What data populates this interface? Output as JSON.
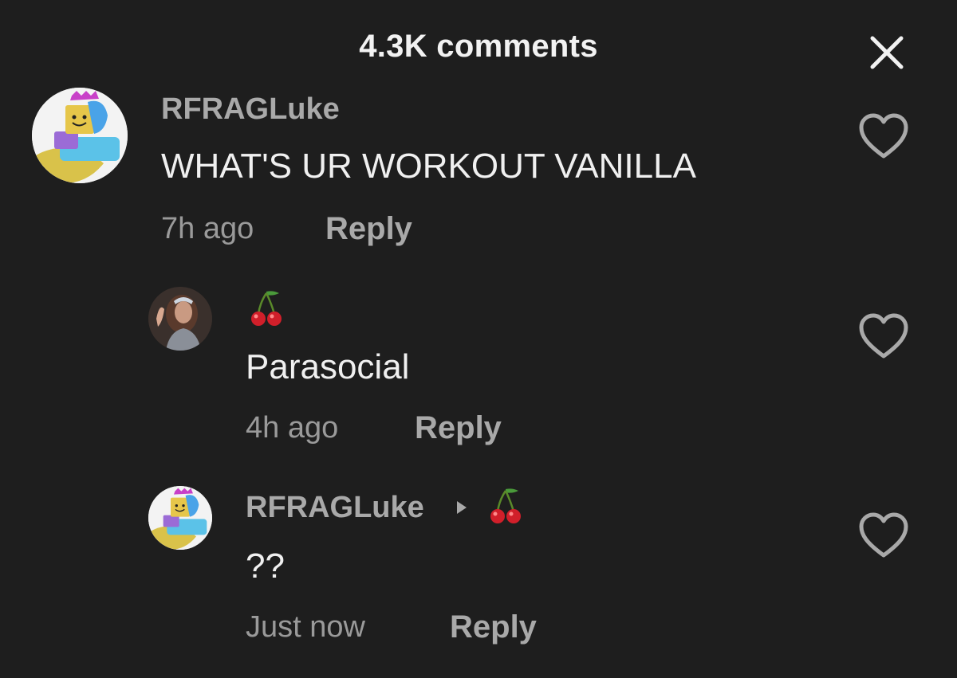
{
  "header": {
    "title": "4.3K comments",
    "close_icon": "close-icon"
  },
  "comments": [
    {
      "username": "RFRAGLuke",
      "text": "WHAT'S UR WORKOUT VANILLA",
      "time": "7h ago",
      "reply_label": "Reply",
      "avatar_icon": "roblox-avatar",
      "like_icon": "heart-outline-icon"
    },
    {
      "username_icon": "cherry-emoji",
      "text": "Parasocial",
      "time": "4h ago",
      "reply_label": "Reply",
      "avatar_icon": "portrait-avatar",
      "like_icon": "heart-outline-icon"
    },
    {
      "username": "RFRAGLuke",
      "reply_to_icon": "cherry-emoji",
      "text": "??",
      "time": "Just now",
      "reply_label": "Reply",
      "avatar_icon": "roblox-avatar",
      "like_icon": "heart-outline-icon"
    }
  ],
  "colors": {
    "background": "#1e1e1e",
    "primary_text": "#f0f0f0",
    "secondary_text": "#a9a9a9"
  }
}
